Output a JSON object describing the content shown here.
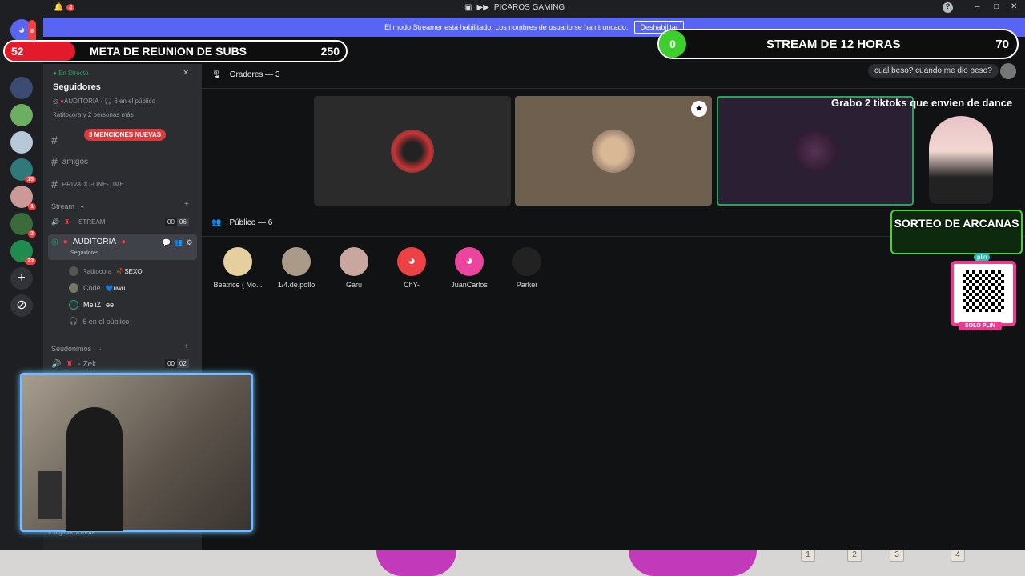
{
  "titlebar": {
    "bell_count": "4",
    "title": "PICAROS GAMING"
  },
  "banner": {
    "message": "El modo Streamer está habilitado. Los nombres de usuario se han truncado.",
    "button": "Deshabilitar"
  },
  "servers": {
    "badges": [
      "8",
      "15",
      "1",
      "3",
      "23"
    ]
  },
  "channels": {
    "live_label": "En Directo",
    "followers_title": "Seguidores",
    "auditoria_line": "AUDITORIA",
    "public_count": "6 en el público",
    "people_line": "Ꝛatitocora y 2 personas más",
    "mentions_badge": "3 MENCIONES NUEVAS",
    "channel_amigos": "amigos",
    "channel_privado": "PRIVADO-ONE-TIME",
    "category_stream": "Stream",
    "channel_stream": "- STREAM",
    "stream_counts": [
      "00",
      "06"
    ],
    "channel_auditoria": "AUDITORIA",
    "auditoria_sub": "Seguidores",
    "members": [
      {
        "name": "Ꝛatitocora",
        "tag": "SEXO"
      },
      {
        "name": "Code",
        "tag": "uwu"
      },
      {
        "name": "MeiiZ",
        "tag": "ɵɵ"
      }
    ],
    "public_line": "6 en el público",
    "category_seudonimos": "Seudonimos",
    "channel_zek": "- Zek",
    "zek_counts": [
      "00",
      "02"
    ],
    "playing": "Jugando a PEAK"
  },
  "main": {
    "speakers_header": "Oradores — 3",
    "public_header": "Público — 6",
    "public_members": [
      "Beatrice ( Mo...",
      "1/4.de.pollo",
      "Garu",
      "ChY-",
      "JuanCarlos",
      "Parker"
    ]
  },
  "overlay": {
    "subs_current": "52",
    "subs_title": "META DE REUNION DE SUBS",
    "subs_goal": "250",
    "stream_current": "0",
    "stream_title": "STREAM DE 12 HORAS",
    "stream_goal": "70",
    "chat_message": "cual beso? cuando me dio beso?",
    "caption": "Grabo 2 tiktoks que envien de dance",
    "sorteo": "SORTEO DE ARCANAS",
    "plin_label": "plin",
    "solo_plin": "SOLO PLIN",
    "keys": [
      "1",
      "2",
      "3",
      "4"
    ]
  },
  "colors": {
    "accent": "#5865f2",
    "live": "#23a55a",
    "danger": "#f23f42",
    "discord_red": "#ed4245",
    "discord_pink": "#eb459e"
  }
}
